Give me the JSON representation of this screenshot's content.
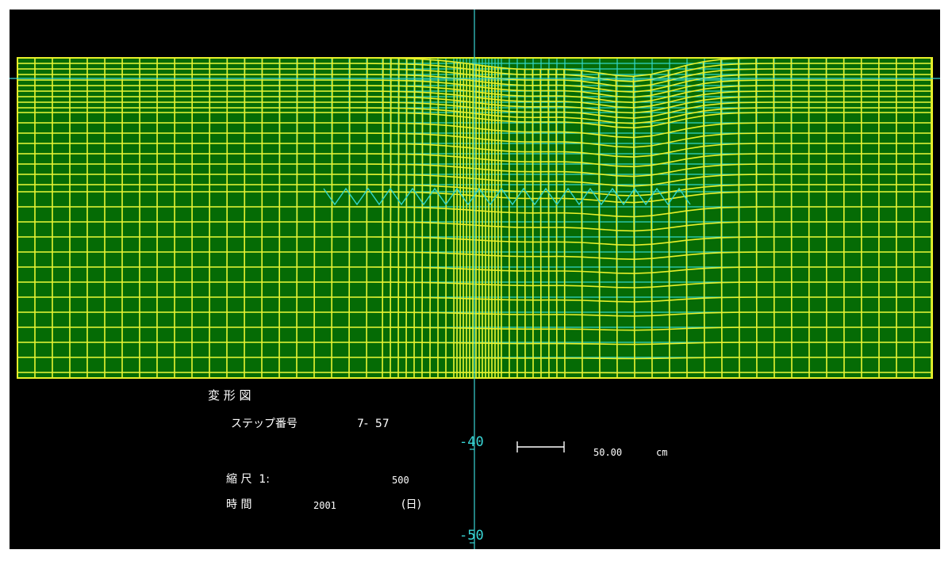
{
  "title": "変 形 図",
  "step": {
    "label": "ステップ番号",
    "value": "7-  57"
  },
  "scale": {
    "label": "縮 尺  1:",
    "value": "500"
  },
  "time": {
    "label": "時 間",
    "value": "2001",
    "unit": "(日)"
  },
  "scale_bar": {
    "value": "50.00",
    "unit": "cm"
  },
  "axis": {
    "tick_upper": "-40",
    "tick_lower": "-50"
  },
  "colors": {
    "background": "#000000",
    "fill": "#056b05",
    "mesh_original": "#33d6c8",
    "mesh_deformed": "#e8f02a",
    "axis": "#39d6d6",
    "text": "#ffffff"
  }
}
